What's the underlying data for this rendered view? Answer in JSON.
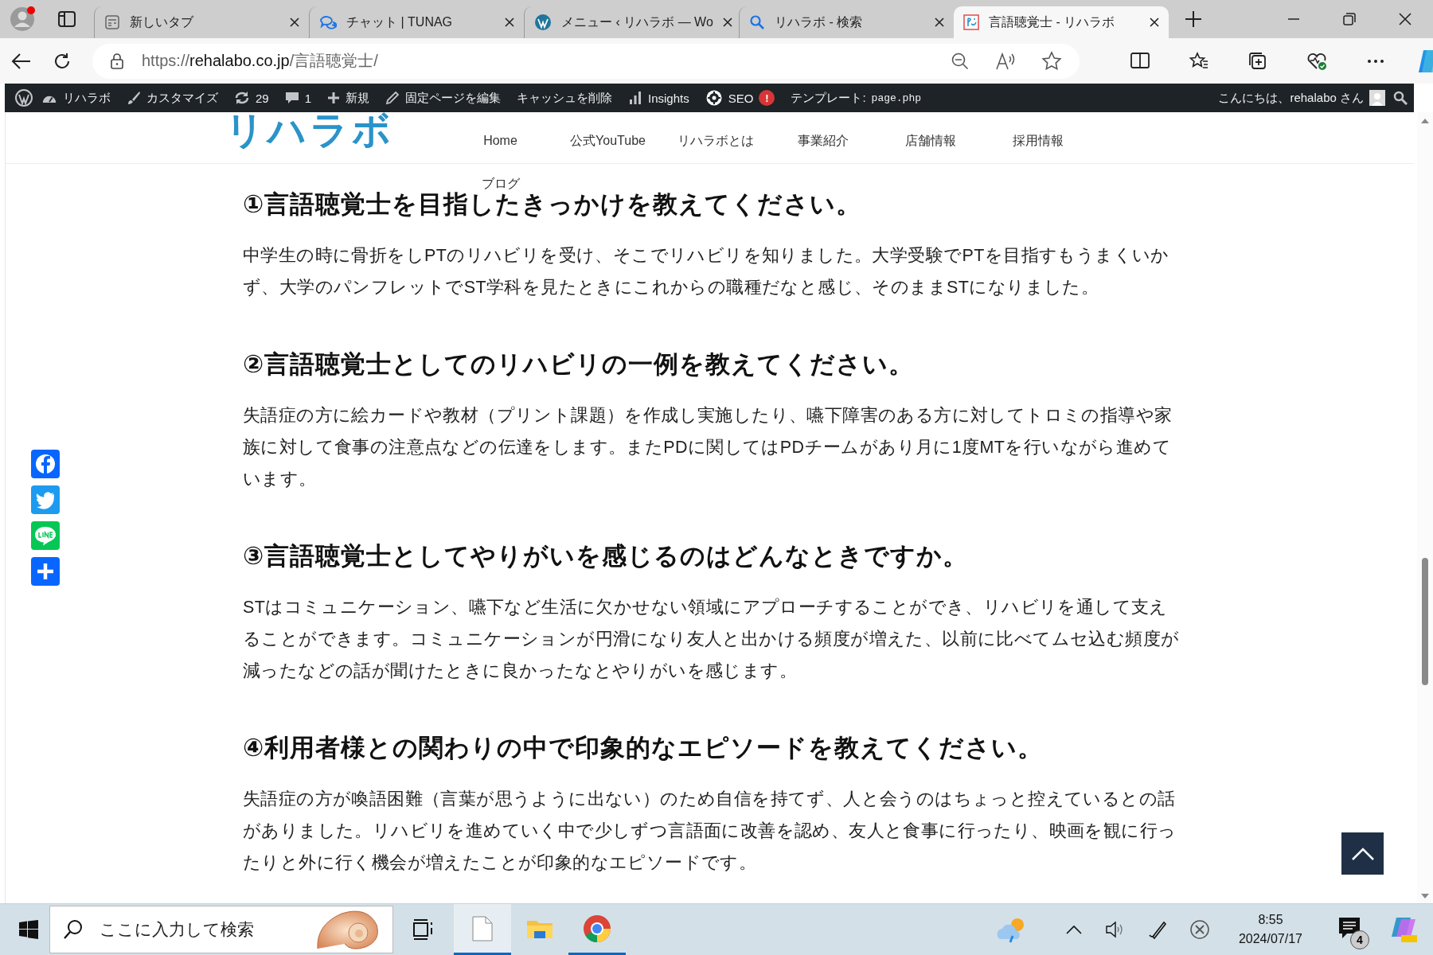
{
  "browser": {
    "tabs": [
      {
        "title": "新しいタブ",
        "kind": "newtab",
        "selected": false
      },
      {
        "title": "チャット | TUNAG",
        "kind": "chat",
        "selected": false
      },
      {
        "title": "メニュー ‹ リハラボ — Wo",
        "kind": "wordpress",
        "selected": false
      },
      {
        "title": "リハラボ - 検索",
        "kind": "search",
        "selected": false
      },
      {
        "title": "言語聴覚士 - リハラボ",
        "kind": "site",
        "selected": true
      }
    ],
    "url": {
      "scheme": "https://",
      "host": "rehalabo.co.jp",
      "path": "/言語聴覚士/"
    }
  },
  "admin_bar": {
    "items": [
      {
        "kind": "site",
        "label": "リハラボ"
      },
      {
        "kind": "customize",
        "label": "カスタマイズ"
      },
      {
        "kind": "updates",
        "label": "29"
      },
      {
        "kind": "comments",
        "label": "1"
      },
      {
        "kind": "new",
        "label": "新規"
      },
      {
        "kind": "edit",
        "label": "固定ページを編集"
      },
      {
        "kind": "plain",
        "label": "キャッシュを削除"
      },
      {
        "kind": "insights",
        "label": "Insights"
      },
      {
        "kind": "seo",
        "label": "SEO",
        "badge": "!"
      },
      {
        "kind": "template",
        "label": "テンプレート:",
        "code": "page.php"
      }
    ],
    "greeting": "こんにちは、rehalabo さん"
  },
  "site": {
    "logo": "リハラボ",
    "nav": [
      {
        "label": "Home"
      },
      {
        "label": "公式YouTube"
      },
      {
        "label": "リハラボとは"
      },
      {
        "label": "事業紹介"
      },
      {
        "label": "店舗情報"
      },
      {
        "label": "採用情報"
      },
      {
        "label": "ブログ"
      }
    ],
    "sections": [
      {
        "heading": "①言語聴覚士を目指したきっかけを教えてください。",
        "body": "中学生の時に骨折をしPTのリハビリを受け、そこでリハビリを知りました。大学受験でPTを目指すもうまくいかず、大学のパンフレットでST学科を見たときにこれからの職種だなと感じ、そのままSTになりました。"
      },
      {
        "heading": "②言語聴覚士としてのリハビリの一例を教えてください。",
        "body": "失語症の方に絵カードや教材（プリント課題）を作成し実施したり、嚥下障害のある方に対してトロミの指導や家族に対して食事の注意点などの伝達をします。またPDに関してはPDチームがあり月に1度MTを行いながら進めています。"
      },
      {
        "heading": "③言語聴覚士としてやりがいを感じるのはどんなときですか。",
        "body": "STはコミュニケーション、嚥下など生活に欠かせない領域にアプローチすることができ、リハビリを通して支えることができます。コミュニケーションが円滑になり友人と出かける頻度が増えた、以前に比べてムセ込む頻度が減ったなどの話が聞けたときに良かったなとやりがいを感じます。"
      },
      {
        "heading": "④利用者様との関わりの中で印象的なエピソードを教えてください。",
        "body": "失語症の方が喚語困難（言葉が思うように出ない）のため自信を持てず、人と会うのはちょっと控えているとの話がありました。リハビリを進めていく中で少しずつ言語面に改善を認め、友人と食事に行ったり、映画を観に行ったりと外に行く機会が増えたことが印象的なエピソードです。"
      }
    ],
    "share": [
      {
        "kind": "facebook"
      },
      {
        "kind": "twitter"
      },
      {
        "kind": "line"
      },
      {
        "kind": "more"
      }
    ]
  },
  "taskbar": {
    "search_placeholder": "ここに入力して検索",
    "apps": [
      {
        "kind": "file",
        "open": true
      },
      {
        "kind": "folder",
        "open": false
      },
      {
        "kind": "chrome",
        "open": true
      }
    ],
    "time": "8:55",
    "date": "2024/07/17",
    "notifications": "4"
  }
}
